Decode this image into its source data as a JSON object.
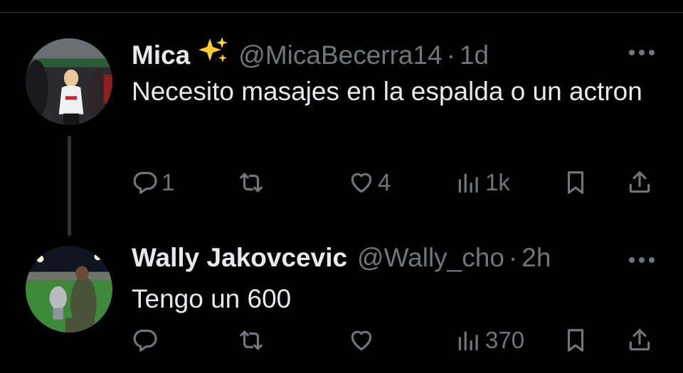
{
  "tweets": [
    {
      "name": "Mica",
      "name_emoji": "sparkles",
      "handle": "@MicaBecerra14",
      "separator": "·",
      "time": "1d",
      "text": "Necesito masajes en la espalda o un actron",
      "replies": "1",
      "retweets": "",
      "likes": "4",
      "views": "1k"
    },
    {
      "name": "Wally Jakovcevic",
      "handle": "@Wally_cho",
      "separator": "·",
      "time": "2h",
      "text": "Tengo un 600",
      "replies": "",
      "retweets": "",
      "likes": "",
      "views": "370"
    }
  ],
  "icons": {
    "reply": "reply-icon",
    "retweet": "retweet-icon",
    "like": "heart-icon",
    "views": "views-icon",
    "bookmark": "bookmark-icon",
    "share": "share-icon",
    "more": "more-icon"
  },
  "colors": {
    "background": "#000000",
    "primary_text": "#e7e9ea",
    "secondary_text": "#71767b",
    "divider": "#2f3336",
    "sparkle": "#ffcc33"
  }
}
